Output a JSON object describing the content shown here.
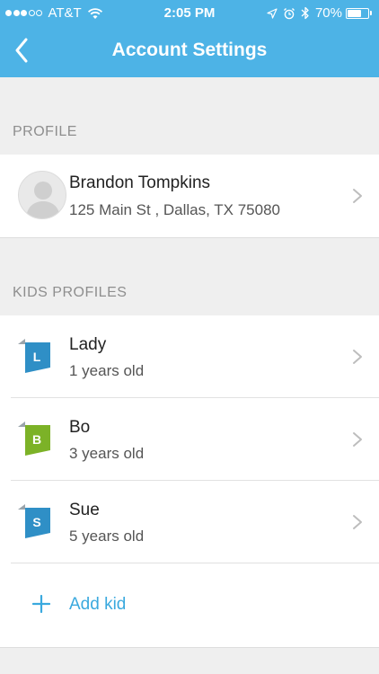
{
  "status_bar": {
    "carrier": "AT&T",
    "signal_bars_filled": 3,
    "signal_bars_total": 5,
    "time": "2:05 PM",
    "battery_percent": "70%",
    "battery_level": 0.7,
    "icons": [
      "wifi-icon",
      "location-icon",
      "alarm-icon",
      "bluetooth-icon",
      "battery-icon"
    ]
  },
  "header": {
    "title": "Account Settings",
    "back_icon": "chevron-left-icon",
    "background_color": "#4db3e6"
  },
  "profile_section": {
    "title": "PROFILE",
    "name": "Brandon Tompkins",
    "address": "125 Main St , Dallas, TX 75080"
  },
  "kids_section": {
    "title": "KIDS PROFILES",
    "kids": [
      {
        "initial": "L",
        "name": "Lady",
        "age": "1 years old",
        "color": "#2f8fc6"
      },
      {
        "initial": "B",
        "name": "Bo",
        "age": "3 years old",
        "color": "#7cb227"
      },
      {
        "initial": "S",
        "name": "Sue",
        "age": "5 years old",
        "color": "#2f8fc6"
      }
    ],
    "add_label": "Add kid",
    "accent_color": "#3aa9de"
  }
}
